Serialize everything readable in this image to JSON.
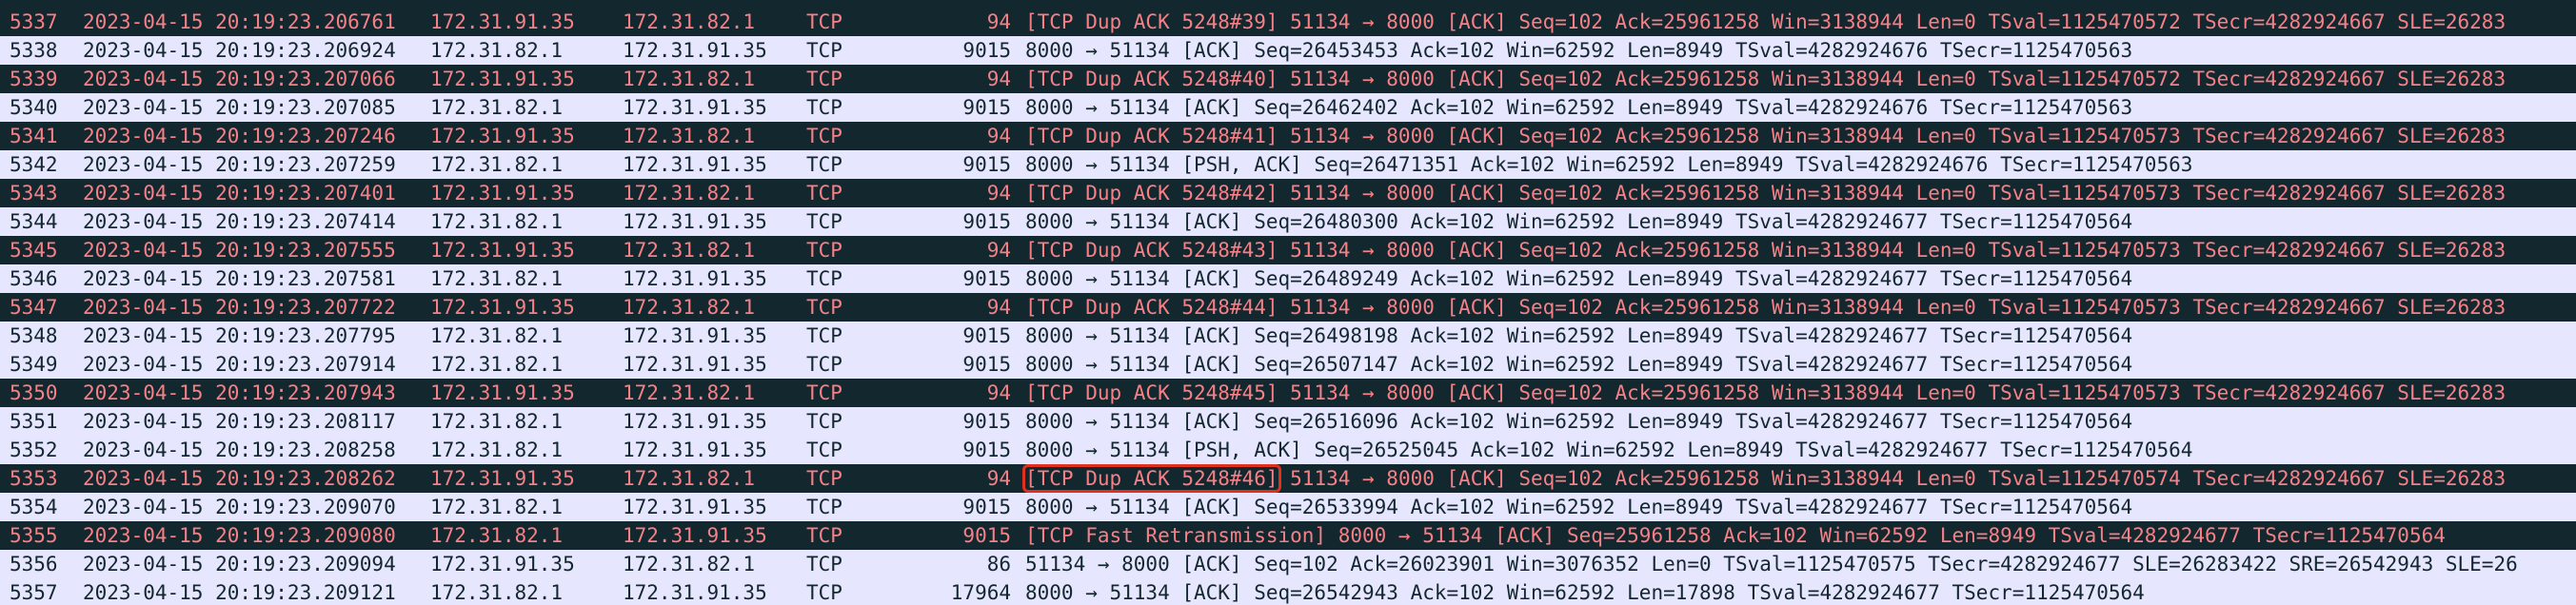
{
  "packets": [
    {
      "no": "5337",
      "time": "2023-04-15 20:19:23.206761",
      "src": "172.31.91.35",
      "dst": "172.31.82.1",
      "proto": "TCP",
      "len": "94",
      "info_hl": "",
      "info": "[TCP Dup ACK 5248#39] 51134 → 8000 [ACK] Seq=102 Ack=25961258 Win=3138944 Len=0 TSval=1125470572 TSecr=4282924667 SLE=26283",
      "bad": true
    },
    {
      "no": "5338",
      "time": "2023-04-15 20:19:23.206924",
      "src": "172.31.82.1",
      "dst": "172.31.91.35",
      "proto": "TCP",
      "len": "9015",
      "info_hl": "",
      "info": "8000 → 51134 [ACK] Seq=26453453 Ack=102 Win=62592 Len=8949 TSval=4282924676 TSecr=1125470563",
      "bad": false
    },
    {
      "no": "5339",
      "time": "2023-04-15 20:19:23.207066",
      "src": "172.31.91.35",
      "dst": "172.31.82.1",
      "proto": "TCP",
      "len": "94",
      "info_hl": "",
      "info": "[TCP Dup ACK 5248#40] 51134 → 8000 [ACK] Seq=102 Ack=25961258 Win=3138944 Len=0 TSval=1125470572 TSecr=4282924667 SLE=26283",
      "bad": true
    },
    {
      "no": "5340",
      "time": "2023-04-15 20:19:23.207085",
      "src": "172.31.82.1",
      "dst": "172.31.91.35",
      "proto": "TCP",
      "len": "9015",
      "info_hl": "",
      "info": "8000 → 51134 [ACK] Seq=26462402 Ack=102 Win=62592 Len=8949 TSval=4282924676 TSecr=1125470563",
      "bad": false
    },
    {
      "no": "5341",
      "time": "2023-04-15 20:19:23.207246",
      "src": "172.31.91.35",
      "dst": "172.31.82.1",
      "proto": "TCP",
      "len": "94",
      "info_hl": "",
      "info": "[TCP Dup ACK 5248#41] 51134 → 8000 [ACK] Seq=102 Ack=25961258 Win=3138944 Len=0 TSval=1125470573 TSecr=4282924667 SLE=26283",
      "bad": true
    },
    {
      "no": "5342",
      "time": "2023-04-15 20:19:23.207259",
      "src": "172.31.82.1",
      "dst": "172.31.91.35",
      "proto": "TCP",
      "len": "9015",
      "info_hl": "",
      "info": "8000 → 51134 [PSH, ACK] Seq=26471351 Ack=102 Win=62592 Len=8949 TSval=4282924676 TSecr=1125470563",
      "bad": false
    },
    {
      "no": "5343",
      "time": "2023-04-15 20:19:23.207401",
      "src": "172.31.91.35",
      "dst": "172.31.82.1",
      "proto": "TCP",
      "len": "94",
      "info_hl": "",
      "info": "[TCP Dup ACK 5248#42] 51134 → 8000 [ACK] Seq=102 Ack=25961258 Win=3138944 Len=0 TSval=1125470573 TSecr=4282924667 SLE=26283",
      "bad": true
    },
    {
      "no": "5344",
      "time": "2023-04-15 20:19:23.207414",
      "src": "172.31.82.1",
      "dst": "172.31.91.35",
      "proto": "TCP",
      "len": "9015",
      "info_hl": "",
      "info": "8000 → 51134 [ACK] Seq=26480300 Ack=102 Win=62592 Len=8949 TSval=4282924677 TSecr=1125470564",
      "bad": false
    },
    {
      "no": "5345",
      "time": "2023-04-15 20:19:23.207555",
      "src": "172.31.91.35",
      "dst": "172.31.82.1",
      "proto": "TCP",
      "len": "94",
      "info_hl": "",
      "info": "[TCP Dup ACK 5248#43] 51134 → 8000 [ACK] Seq=102 Ack=25961258 Win=3138944 Len=0 TSval=1125470573 TSecr=4282924667 SLE=26283",
      "bad": true
    },
    {
      "no": "5346",
      "time": "2023-04-15 20:19:23.207581",
      "src": "172.31.82.1",
      "dst": "172.31.91.35",
      "proto": "TCP",
      "len": "9015",
      "info_hl": "",
      "info": "8000 → 51134 [ACK] Seq=26489249 Ack=102 Win=62592 Len=8949 TSval=4282924677 TSecr=1125470564",
      "bad": false
    },
    {
      "no": "5347",
      "time": "2023-04-15 20:19:23.207722",
      "src": "172.31.91.35",
      "dst": "172.31.82.1",
      "proto": "TCP",
      "len": "94",
      "info_hl": "",
      "info": "[TCP Dup ACK 5248#44] 51134 → 8000 [ACK] Seq=102 Ack=25961258 Win=3138944 Len=0 TSval=1125470573 TSecr=4282924667 SLE=26283",
      "bad": true
    },
    {
      "no": "5348",
      "time": "2023-04-15 20:19:23.207795",
      "src": "172.31.82.1",
      "dst": "172.31.91.35",
      "proto": "TCP",
      "len": "9015",
      "info_hl": "",
      "info": "8000 → 51134 [ACK] Seq=26498198 Ack=102 Win=62592 Len=8949 TSval=4282924677 TSecr=1125470564",
      "bad": false
    },
    {
      "no": "5349",
      "time": "2023-04-15 20:19:23.207914",
      "src": "172.31.82.1",
      "dst": "172.31.91.35",
      "proto": "TCP",
      "len": "9015",
      "info_hl": "",
      "info": "8000 → 51134 [ACK] Seq=26507147 Ack=102 Win=62592 Len=8949 TSval=4282924677 TSecr=1125470564",
      "bad": false
    },
    {
      "no": "5350",
      "time": "2023-04-15 20:19:23.207943",
      "src": "172.31.91.35",
      "dst": "172.31.82.1",
      "proto": "TCP",
      "len": "94",
      "info_hl": "",
      "info": "[TCP Dup ACK 5248#45] 51134 → 8000 [ACK] Seq=102 Ack=25961258 Win=3138944 Len=0 TSval=1125470573 TSecr=4282924667 SLE=26283",
      "bad": true
    },
    {
      "no": "5351",
      "time": "2023-04-15 20:19:23.208117",
      "src": "172.31.82.1",
      "dst": "172.31.91.35",
      "proto": "TCP",
      "len": "9015",
      "info_hl": "",
      "info": "8000 → 51134 [ACK] Seq=26516096 Ack=102 Win=62592 Len=8949 TSval=4282924677 TSecr=1125470564",
      "bad": false
    },
    {
      "no": "5352",
      "time": "2023-04-15 20:19:23.208258",
      "src": "172.31.82.1",
      "dst": "172.31.91.35",
      "proto": "TCP",
      "len": "9015",
      "info_hl": "",
      "info": "8000 → 51134 [PSH, ACK] Seq=26525045 Ack=102 Win=62592 Len=8949 TSval=4282924677 TSecr=1125470564",
      "bad": false
    },
    {
      "no": "5353",
      "time": "2023-04-15 20:19:23.208262",
      "src": "172.31.91.35",
      "dst": "172.31.82.1",
      "proto": "TCP",
      "len": "94",
      "info_hl": "[TCP Dup ACK 5248#46]",
      "info": " 51134 → 8000 [ACK] Seq=102 Ack=25961258 Win=3138944 Len=0 TSval=1125470574 TSecr=4282924667 SLE=26283",
      "bad": true
    },
    {
      "no": "5354",
      "time": "2023-04-15 20:19:23.209070",
      "src": "172.31.82.1",
      "dst": "172.31.91.35",
      "proto": "TCP",
      "len": "9015",
      "info_hl": "",
      "info": "8000 → 51134 [ACK] Seq=26533994 Ack=102 Win=62592 Len=8949 TSval=4282924677 TSecr=1125470564",
      "bad": false
    },
    {
      "no": "5355",
      "time": "2023-04-15 20:19:23.209080",
      "src": "172.31.82.1",
      "dst": "172.31.91.35",
      "proto": "TCP",
      "len": "9015",
      "info_hl": "",
      "info": "[TCP Fast Retransmission] 8000 → 51134 [ACK] Seq=25961258 Ack=102 Win=62592 Len=8949 TSval=4282924677 TSecr=1125470564",
      "bad": true
    },
    {
      "no": "5356",
      "time": "2023-04-15 20:19:23.209094",
      "src": "172.31.91.35",
      "dst": "172.31.82.1",
      "proto": "TCP",
      "len": "86",
      "info_hl": "",
      "info": "51134 → 8000 [ACK] Seq=102 Ack=26023901 Win=3076352 Len=0 TSval=1125470575 TSecr=4282924677 SLE=26283422 SRE=26542943 SLE=26",
      "bad": false
    },
    {
      "no": "5357",
      "time": "2023-04-15 20:19:23.209121",
      "src": "172.31.82.1",
      "dst": "172.31.91.35",
      "proto": "TCP",
      "len": "17964",
      "info_hl": "",
      "info": "8000 → 51134 [ACK] Seq=26542943 Ack=102 Win=62592 Len=17898 TSval=4282924677 TSecr=1125470564",
      "bad": false
    }
  ],
  "colors": {
    "normal_bg": "#e7e6ff",
    "normal_fg": "#12272e",
    "bad_bg": "#12272e",
    "bad_fg": "#f78087",
    "highlight_box": "#e0311c"
  }
}
